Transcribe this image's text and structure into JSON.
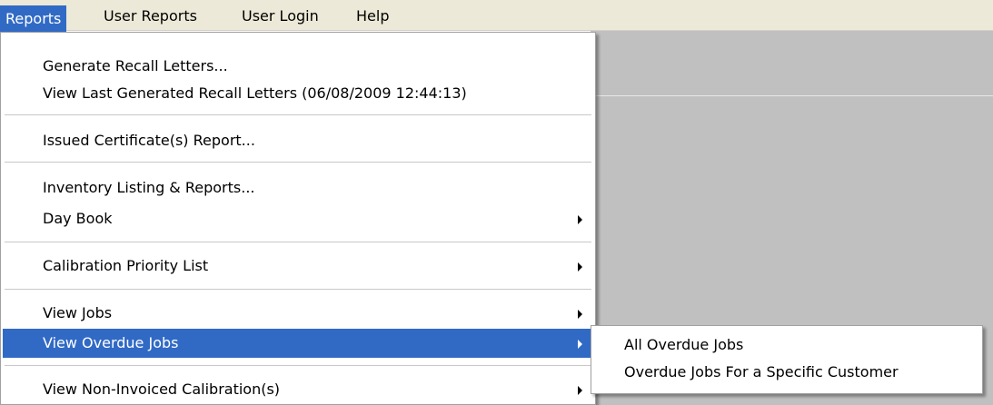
{
  "menubar": {
    "items": [
      {
        "label": "Reports"
      },
      {
        "label": "User Reports"
      },
      {
        "label": "User Login"
      },
      {
        "label": "Help"
      }
    ]
  },
  "reports_menu": {
    "items": [
      {
        "label": "Generate Recall Letters..."
      },
      {
        "label": "View Last Generated Recall Letters (06/08/2009 12:44:13)"
      },
      {
        "label": "Issued Certificate(s) Report..."
      },
      {
        "label": "Inventory Listing & Reports..."
      },
      {
        "label": "Day Book"
      },
      {
        "label": "Calibration Priority List"
      },
      {
        "label": "View Jobs"
      },
      {
        "label": "View Overdue Jobs"
      },
      {
        "label": "View Non-Invoiced Calibration(s)"
      }
    ]
  },
  "overdue_submenu": {
    "items": [
      {
        "label": "All Overdue Jobs"
      },
      {
        "label": "Overdue Jobs For a Specific Customer"
      }
    ]
  },
  "colors": {
    "highlight": "#316ac5",
    "menubar_bg": "#ece9d8",
    "workspace_bg": "#c0c0c0"
  }
}
